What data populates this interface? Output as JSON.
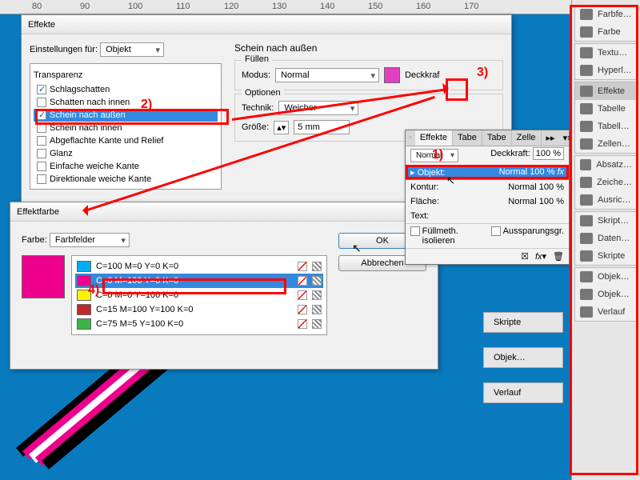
{
  "ruler_marks": [
    "80",
    "90",
    "100",
    "110",
    "120",
    "130",
    "140",
    "150",
    "160",
    "170"
  ],
  "dialog_effects": {
    "title": "Effekte",
    "settings_for_label": "Einstellungen für:",
    "settings_for_value": "Objekt",
    "list_title": "Transparenz",
    "items": [
      {
        "label": "Schlagschatten",
        "checked": true
      },
      {
        "label": "Schatten nach innen",
        "checked": false
      },
      {
        "label": "Schein nach außen",
        "checked": true,
        "selected": true
      },
      {
        "label": "Schein nach innen",
        "checked": false
      },
      {
        "label": "Abgeflachte Kante und Relief",
        "checked": false
      },
      {
        "label": "Glanz",
        "checked": false
      },
      {
        "label": "Einfache weiche Kante",
        "checked": false
      },
      {
        "label": "Direktionale weiche Kante",
        "checked": false
      }
    ],
    "right_title": "Schein nach außen",
    "fill_group": "Füllen",
    "mode_label": "Modus:",
    "mode_value": "Normal",
    "opacity_label": "Deckkraf",
    "color_hex": "#e040c0",
    "options_group": "Optionen",
    "technique_label": "Technik:",
    "technique_value": "Weicher",
    "size_label": "Größe:",
    "size_value": "5 mm"
  },
  "dialog_color": {
    "title": "Effektfarbe",
    "color_label": "Farbe:",
    "color_mode": "Farbfelder",
    "swatches": [
      {
        "label": "C=100 M=0 Y=0 K=0",
        "color": "#00aeef"
      },
      {
        "label": "C=0 M=100 Y=0 K=0",
        "color": "#ec008c",
        "selected": true
      },
      {
        "label": "C=0 M=0 Y=100 K=0",
        "color": "#fff200"
      },
      {
        "label": "C=15 M=100 Y=100 K=0",
        "color": "#c1272d"
      },
      {
        "label": "C=75 M=5 Y=100 K=0",
        "color": "#39b54a"
      }
    ],
    "preview_color": "#ec008c",
    "ok": "OK",
    "cancel": "Abbrechen"
  },
  "panel_effects": {
    "tabs": [
      "Effekte",
      "Tabe",
      "Tabe",
      "Zelle"
    ],
    "blend": "Normal",
    "opacity_label": "Deckkraft:",
    "opacity_value": "100 %",
    "rows": [
      {
        "name": "Objekt:",
        "value": "Normal 100 %",
        "selected": true,
        "fx": "fx"
      },
      {
        "name": "Kontur:",
        "value": "Normal 100 %"
      },
      {
        "name": "Fläche:",
        "value": "Normal 100 %"
      },
      {
        "name": "Text:",
        "value": ""
      }
    ],
    "fillmeth": "Füllmeth. isolieren",
    "aussp": "Aussparungsgr."
  },
  "collapsed_panels": [
    "Skripte",
    "Objek…",
    "Verlauf"
  ],
  "side_panels": [
    [
      "Farbfe…",
      "Farbe"
    ],
    [
      "Textu…",
      "Hyperl…"
    ],
    [
      "Effekte",
      "Tabelle",
      "Tabell…",
      "Zellen…"
    ],
    [
      "Absatz…",
      "Zeiche…",
      "Ausric…"
    ],
    [
      "Skript…",
      "Daten…",
      "Skripte"
    ],
    [
      "Objek…",
      "Objek…",
      "Verlauf"
    ]
  ],
  "annotations": {
    "a1": "1)",
    "a2": "2)",
    "a3": "3)",
    "a4": "4)"
  }
}
